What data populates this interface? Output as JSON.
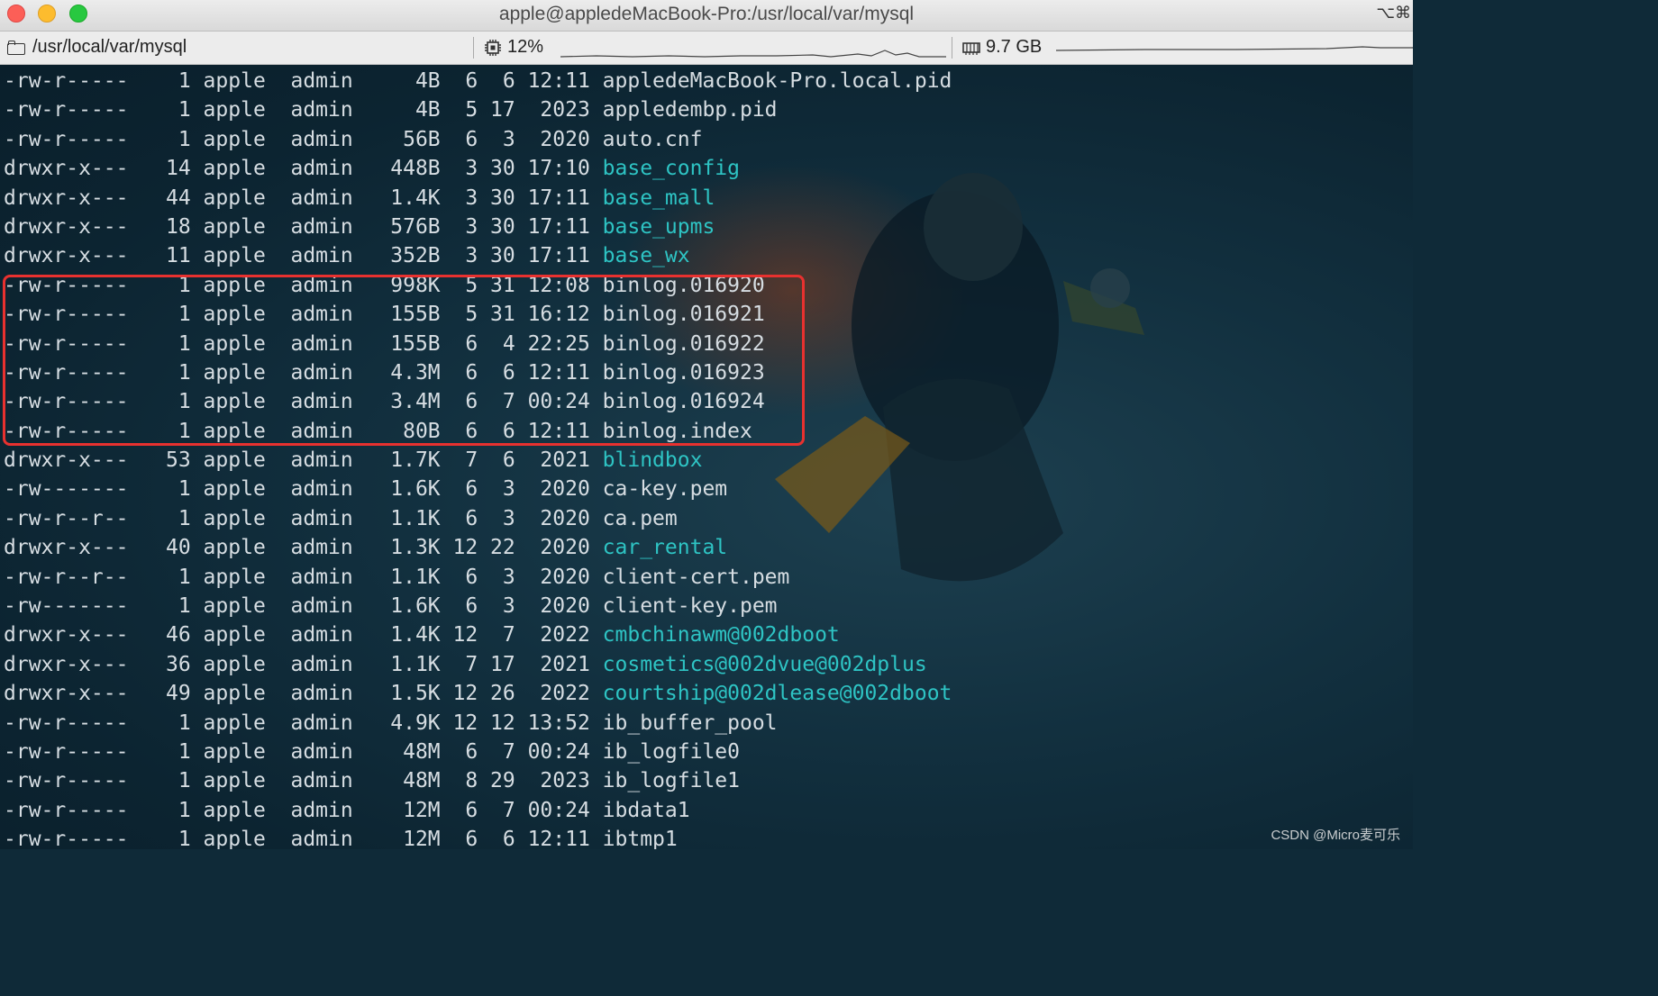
{
  "window": {
    "title": "apple@appledeMacBook-Pro:/usr/local/var/mysql",
    "shortcut": "⌥⌘"
  },
  "statusbar": {
    "path": "/usr/local/var/mysql",
    "cpu": "12%",
    "memory": "9.7 GB"
  },
  "terminal": {
    "lines": [
      {
        "perm": "-rw-r-----",
        "links": "1",
        "owner": "apple",
        "group": "admin",
        "size": "4B",
        "month": "6",
        "day": "6",
        "time": "12:11",
        "name": "appledeMacBook-Pro.local.pid",
        "dir": false
      },
      {
        "perm": "-rw-r-----",
        "links": "1",
        "owner": "apple",
        "group": "admin",
        "size": "4B",
        "month": "5",
        "day": "17",
        "time": "2023",
        "name": "appledembp.pid",
        "dir": false
      },
      {
        "perm": "-rw-r-----",
        "links": "1",
        "owner": "apple",
        "group": "admin",
        "size": "56B",
        "month": "6",
        "day": "3",
        "time": "2020",
        "name": "auto.cnf",
        "dir": false
      },
      {
        "perm": "drwxr-x---",
        "links": "14",
        "owner": "apple",
        "group": "admin",
        "size": "448B",
        "month": "3",
        "day": "30",
        "time": "17:10",
        "name": "base_config",
        "dir": true
      },
      {
        "perm": "drwxr-x---",
        "links": "44",
        "owner": "apple",
        "group": "admin",
        "size": "1.4K",
        "month": "3",
        "day": "30",
        "time": "17:11",
        "name": "base_mall",
        "dir": true
      },
      {
        "perm": "drwxr-x---",
        "links": "18",
        "owner": "apple",
        "group": "admin",
        "size": "576B",
        "month": "3",
        "day": "30",
        "time": "17:11",
        "name": "base_upms",
        "dir": true
      },
      {
        "perm": "drwxr-x---",
        "links": "11",
        "owner": "apple",
        "group": "admin",
        "size": "352B",
        "month": "3",
        "day": "30",
        "time": "17:11",
        "name": "base_wx",
        "dir": true
      },
      {
        "perm": "-rw-r-----",
        "links": "1",
        "owner": "apple",
        "group": "admin",
        "size": "998K",
        "month": "5",
        "day": "31",
        "time": "12:08",
        "name": "binlog.016920",
        "dir": false
      },
      {
        "perm": "-rw-r-----",
        "links": "1",
        "owner": "apple",
        "group": "admin",
        "size": "155B",
        "month": "5",
        "day": "31",
        "time": "16:12",
        "name": "binlog.016921",
        "dir": false
      },
      {
        "perm": "-rw-r-----",
        "links": "1",
        "owner": "apple",
        "group": "admin",
        "size": "155B",
        "month": "6",
        "day": "4",
        "time": "22:25",
        "name": "binlog.016922",
        "dir": false
      },
      {
        "perm": "-rw-r-----",
        "links": "1",
        "owner": "apple",
        "group": "admin",
        "size": "4.3M",
        "month": "6",
        "day": "6",
        "time": "12:11",
        "name": "binlog.016923",
        "dir": false
      },
      {
        "perm": "-rw-r-----",
        "links": "1",
        "owner": "apple",
        "group": "admin",
        "size": "3.4M",
        "month": "6",
        "day": "7",
        "time": "00:24",
        "name": "binlog.016924",
        "dir": false
      },
      {
        "perm": "-rw-r-----",
        "links": "1",
        "owner": "apple",
        "group": "admin",
        "size": "80B",
        "month": "6",
        "day": "6",
        "time": "12:11",
        "name": "binlog.index",
        "dir": false
      },
      {
        "perm": "drwxr-x---",
        "links": "53",
        "owner": "apple",
        "group": "admin",
        "size": "1.7K",
        "month": "7",
        "day": "6",
        "time": "2021",
        "name": "blindbox",
        "dir": true
      },
      {
        "perm": "-rw-------",
        "links": "1",
        "owner": "apple",
        "group": "admin",
        "size": "1.6K",
        "month": "6",
        "day": "3",
        "time": "2020",
        "name": "ca-key.pem",
        "dir": false
      },
      {
        "perm": "-rw-r--r--",
        "links": "1",
        "owner": "apple",
        "group": "admin",
        "size": "1.1K",
        "month": "6",
        "day": "3",
        "time": "2020",
        "name": "ca.pem",
        "dir": false
      },
      {
        "perm": "drwxr-x---",
        "links": "40",
        "owner": "apple",
        "group": "admin",
        "size": "1.3K",
        "month": "12",
        "day": "22",
        "time": "2020",
        "name": "car_rental",
        "dir": true
      },
      {
        "perm": "-rw-r--r--",
        "links": "1",
        "owner": "apple",
        "group": "admin",
        "size": "1.1K",
        "month": "6",
        "day": "3",
        "time": "2020",
        "name": "client-cert.pem",
        "dir": false
      },
      {
        "perm": "-rw-------",
        "links": "1",
        "owner": "apple",
        "group": "admin",
        "size": "1.6K",
        "month": "6",
        "day": "3",
        "time": "2020",
        "name": "client-key.pem",
        "dir": false
      },
      {
        "perm": "drwxr-x---",
        "links": "46",
        "owner": "apple",
        "group": "admin",
        "size": "1.4K",
        "month": "12",
        "day": "7",
        "time": "2022",
        "name": "cmbchinawm@002dboot",
        "dir": true
      },
      {
        "perm": "drwxr-x---",
        "links": "36",
        "owner": "apple",
        "group": "admin",
        "size": "1.1K",
        "month": "7",
        "day": "17",
        "time": "2021",
        "name": "cosmetics@002dvue@002dplus",
        "dir": true
      },
      {
        "perm": "drwxr-x---",
        "links": "49",
        "owner": "apple",
        "group": "admin",
        "size": "1.5K",
        "month": "12",
        "day": "26",
        "time": "2022",
        "name": "courtship@002dlease@002dboot",
        "dir": true
      },
      {
        "perm": "-rw-r-----",
        "links": "1",
        "owner": "apple",
        "group": "admin",
        "size": "4.9K",
        "month": "12",
        "day": "12",
        "time": "13:52",
        "name": "ib_buffer_pool",
        "dir": false
      },
      {
        "perm": "-rw-r-----",
        "links": "1",
        "owner": "apple",
        "group": "admin",
        "size": "48M",
        "month": "6",
        "day": "7",
        "time": "00:24",
        "name": "ib_logfile0",
        "dir": false
      },
      {
        "perm": "-rw-r-----",
        "links": "1",
        "owner": "apple",
        "group": "admin",
        "size": "48M",
        "month": "8",
        "day": "29",
        "time": "2023",
        "name": "ib_logfile1",
        "dir": false
      },
      {
        "perm": "-rw-r-----",
        "links": "1",
        "owner": "apple",
        "group": "admin",
        "size": "12M",
        "month": "6",
        "day": "7",
        "time": "00:24",
        "name": "ibdata1",
        "dir": false
      },
      {
        "perm": "-rw-r-----",
        "links": "1",
        "owner": "apple",
        "group": "admin",
        "size": "12M",
        "month": "6",
        "day": "6",
        "time": "12:11",
        "name": "ibtmp1",
        "dir": false
      }
    ]
  },
  "watermark": "CSDN @Micro麦可乐",
  "colors": {
    "directory": "#2ec4c4",
    "text": "#d6dde2",
    "highlight": "#e8312f",
    "background": "#0f2a38"
  },
  "icons": [
    "folder-icon",
    "cpu-icon",
    "memory-icon"
  ]
}
